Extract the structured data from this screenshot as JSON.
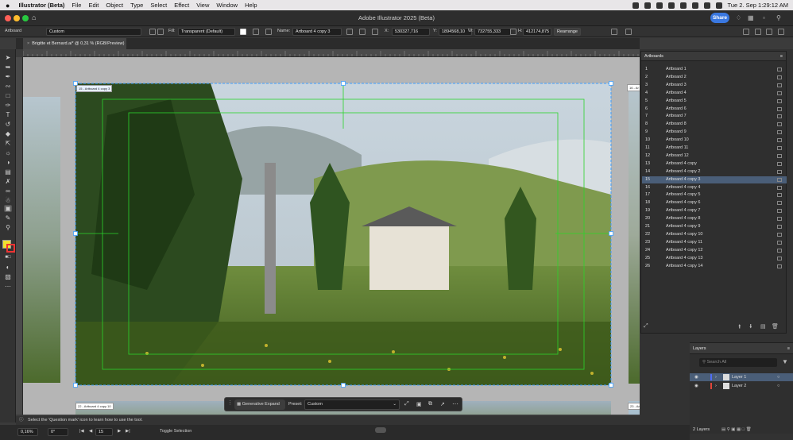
{
  "menubar": {
    "app_name": "Illustrator (Beta)",
    "items": [
      "File",
      "Edit",
      "Object",
      "Type",
      "Select",
      "Effect",
      "View",
      "Window",
      "Help"
    ],
    "clock": "Tue 2. Sep  1:29:12 AM"
  },
  "window": {
    "title": "Adobe Illustrator 2025 (Beta)",
    "share_label": "Share"
  },
  "control_bar": {
    "mode_label": "Artboard",
    "preset_value": "Custom",
    "fill_label": "Fill:",
    "fill_value": "Transparent (Default)",
    "name_label": "Name:",
    "name_value": "Artboard 4 copy 3",
    "x_label": "X:",
    "x_value": "530327,716",
    "y_label": "Y:",
    "y_value": "1894568,10",
    "w_label": "W:",
    "w_value": "732755,333",
    "h_label": "H:",
    "h_value": "412174,875",
    "rearrange_label": "Rearrange"
  },
  "document_tab": {
    "title": "Brigitte et Bernard.ai* @ 0,31 % (RGB/Preview)"
  },
  "canvas": {
    "active_artboard_label": "15 - Artboard 4 copy 3",
    "right_artboard_label": "16 - Ar",
    "bottom_left_label": "22 - Artboard 4 copy 10",
    "bottom_right_label": "23 - Artboard 4 copy 11"
  },
  "artboards_panel": {
    "title": "Artboards",
    "selected_index": 15,
    "rows": [
      {
        "num": "1",
        "name": "Artboard 1"
      },
      {
        "num": "2",
        "name": "Artboard 2"
      },
      {
        "num": "3",
        "name": "Artboard 3"
      },
      {
        "num": "4",
        "name": "Artboard 4"
      },
      {
        "num": "5",
        "name": "Artboard 5"
      },
      {
        "num": "6",
        "name": "Artboard 6"
      },
      {
        "num": "7",
        "name": "Artboard 7"
      },
      {
        "num": "8",
        "name": "Artboard 8"
      },
      {
        "num": "9",
        "name": "Artboard 9"
      },
      {
        "num": "10",
        "name": "Artboard 10"
      },
      {
        "num": "11",
        "name": "Artboard 11"
      },
      {
        "num": "12",
        "name": "Artboard 12"
      },
      {
        "num": "13",
        "name": "Artboard 4 copy"
      },
      {
        "num": "14",
        "name": "Artboard 4 copy 2"
      },
      {
        "num": "15",
        "name": "Artboard 4 copy 3"
      },
      {
        "num": "16",
        "name": "Artboard 4 copy 4"
      },
      {
        "num": "17",
        "name": "Artboard 4 copy 5"
      },
      {
        "num": "18",
        "name": "Artboard 4 copy 6"
      },
      {
        "num": "19",
        "name": "Artboard 4 copy 7"
      },
      {
        "num": "20",
        "name": "Artboard 4 copy 8"
      },
      {
        "num": "21",
        "name": "Artboard 4 copy 9"
      },
      {
        "num": "22",
        "name": "Artboard 4 copy 10"
      },
      {
        "num": "23",
        "name": "Artboard 4 copy 11"
      },
      {
        "num": "24",
        "name": "Artboard 4 copy 12"
      },
      {
        "num": "25",
        "name": "Artboard 4 copy 13"
      },
      {
        "num": "26",
        "name": "Artboard 4 copy 14"
      }
    ]
  },
  "layers_panel": {
    "title": "Layers",
    "search_placeholder": "Search All",
    "layers": [
      {
        "name": "Layer 1",
        "color": "#4f6df5"
      },
      {
        "name": "Layer 2",
        "color": "#e0453a"
      }
    ],
    "count_label": "2 Layers"
  },
  "generative_bar": {
    "button_label": "Generative Expand",
    "preset_label": "Preset:",
    "preset_value": "Custom"
  },
  "hint_text": "Select the 'Question mark' icon to learn how to use the tool.",
  "status_bar": {
    "zoom": "0,16%",
    "rotation": "0°",
    "artboard_number": "15",
    "tool_label": "Toggle Selection"
  },
  "colors": {
    "accent_blue": "#3a78e0",
    "guide_green": "#2bd42b",
    "selection_blue": "#4a5e78",
    "fill_swatch": "#f0e030"
  }
}
